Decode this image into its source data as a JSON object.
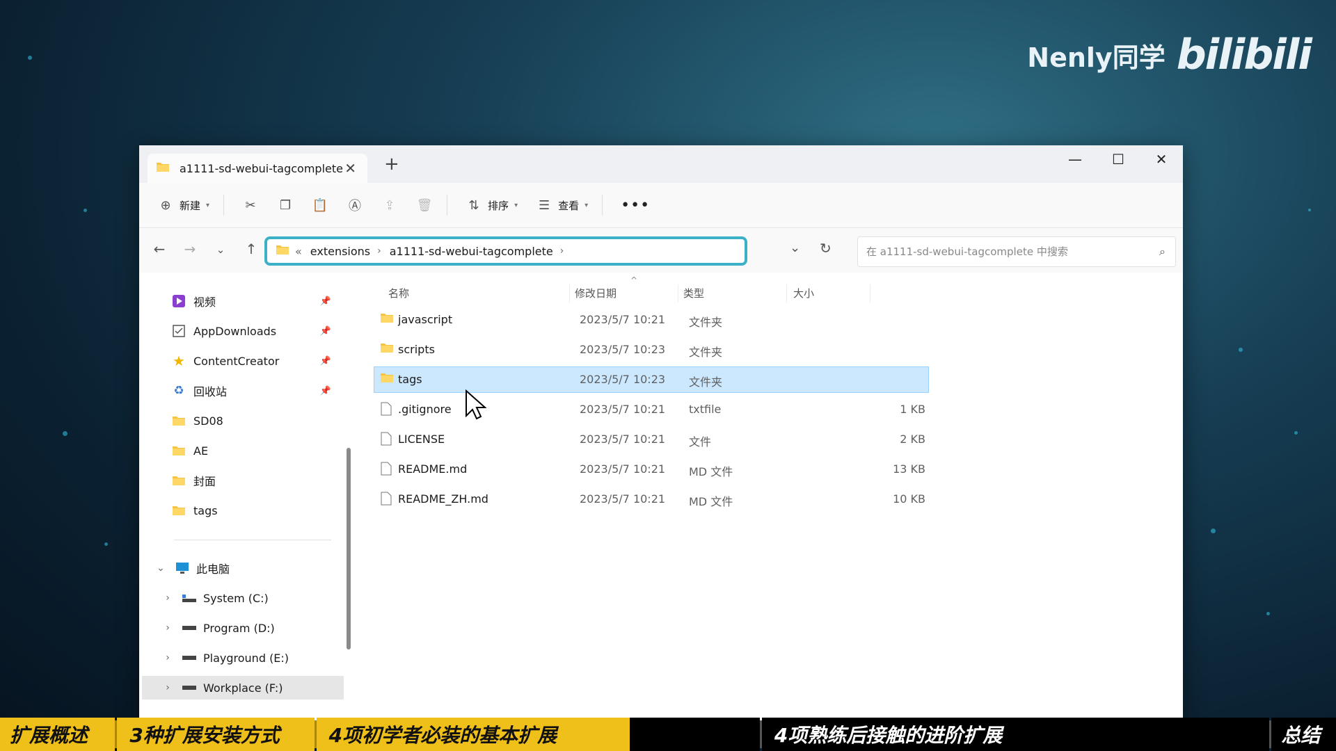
{
  "brand": {
    "name": "Nenly同学",
    "logo": "bilibili"
  },
  "window": {
    "tab_title": "a1111-sd-webui-tagcomplete",
    "toolbar": {
      "new_label": "新建",
      "sort_label": "排序",
      "view_label": "查看"
    },
    "address": {
      "overflow": "«",
      "crumbs": [
        "extensions",
        "a1111-sd-webui-tagcomplete"
      ]
    },
    "search": {
      "placeholder": "在 a1111-sd-webui-tagcomplete 中搜索"
    },
    "sidebar": {
      "quick_access": [
        {
          "label": "视频",
          "icon": "video-icon",
          "pinned": true
        },
        {
          "label": "AppDownloads",
          "icon": "downloads-icon",
          "pinned": true
        },
        {
          "label": "ContentCreator",
          "icon": "star-icon",
          "pinned": true
        },
        {
          "label": "回收站",
          "icon": "recycle-bin-icon",
          "pinned": true
        },
        {
          "label": "SD08",
          "icon": "folder-icon",
          "pinned": false
        },
        {
          "label": "AE",
          "icon": "folder-icon",
          "pinned": false
        },
        {
          "label": "封面",
          "icon": "folder-icon",
          "pinned": false
        },
        {
          "label": "tags",
          "icon": "folder-icon",
          "pinned": false
        }
      ],
      "this_pc": "此电脑",
      "drives": [
        {
          "label": "System (C:)"
        },
        {
          "label": "Program (D:)"
        },
        {
          "label": "Playground (E:)"
        },
        {
          "label": "Workplace (F:)",
          "selected": true
        }
      ]
    },
    "columns": {
      "name": "名称",
      "date": "修改日期",
      "type": "类型",
      "size": "大小"
    },
    "files": [
      {
        "name": "javascript",
        "date": "2023/5/7 10:21",
        "type": "文件夹",
        "size": "",
        "kind": "folder"
      },
      {
        "name": "scripts",
        "date": "2023/5/7 10:23",
        "type": "文件夹",
        "size": "",
        "kind": "folder"
      },
      {
        "name": "tags",
        "date": "2023/5/7 10:23",
        "type": "文件夹",
        "size": "",
        "kind": "folder",
        "selected": true
      },
      {
        "name": ".gitignore",
        "date": "2023/5/7 10:21",
        "type": "txtfile",
        "size": "1 KB",
        "kind": "file"
      },
      {
        "name": "LICENSE",
        "date": "2023/5/7 10:21",
        "type": "文件",
        "size": "2 KB",
        "kind": "file"
      },
      {
        "name": "README.md",
        "date": "2023/5/7 10:21",
        "type": "MD 文件",
        "size": "13 KB",
        "kind": "file"
      },
      {
        "name": "README_ZH.md",
        "date": "2023/5/7 10:21",
        "type": "MD 文件",
        "size": "10 KB",
        "kind": "file"
      }
    ]
  },
  "chapter_bar": [
    "扩展概述",
    "3种扩展安装方式",
    "4项初学者必装的基本扩展",
    "4项熟练后接触的进阶扩展",
    "总结"
  ]
}
